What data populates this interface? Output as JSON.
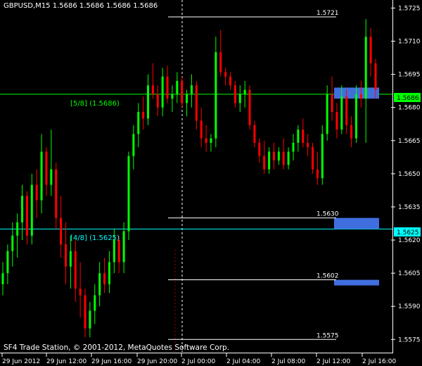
{
  "window": {
    "symbol_header": "GBPUSD,M15  1.5686 1.5686 1.5686 1.5686",
    "copyright": "SF4 Trade Station, © 2001-2012, MetaQuotes Software Corp."
  },
  "colors": {
    "background": "#000000",
    "bull_candle": "#00ff00",
    "bear_candle": "#ff0000",
    "fib_5_8_line": "#00ff00",
    "fib_4_8_line": "#00ffff",
    "zone": "#3f6fdf",
    "level_line": "#ffffff",
    "current_price_marker": "#00ff00",
    "fib_4_8_marker": "#00ffff"
  },
  "chart_data": {
    "type": "candlestick",
    "ylim": [
      1.557,
      1.5728
    ],
    "price_ticks": [
      "1.5725",
      "1.5710",
      "1.5695",
      "1.5680",
      "1.5665",
      "1.5650",
      "1.5635",
      "1.5620",
      "1.5605",
      "1.5590",
      "1.5575"
    ],
    "price_tick_values": [
      1.5725,
      1.571,
      1.5695,
      1.568,
      1.5665,
      1.565,
      1.5635,
      1.562,
      1.5605,
      1.559,
      1.5575
    ],
    "time_ticks": [
      "29 Jun 2012",
      "29 Jun 12:00",
      "29 Jun 16:00",
      "29 Jun 20:00",
      "2 Jul 00:00",
      "2 Jul 04:00",
      "2 Jul 08:00",
      "2 Jul 12:00",
      "2 Jul 16:00"
    ],
    "current_price": "1.5686",
    "horizontal_lines": [
      {
        "name": "[5/8]",
        "label": "[5/8]  (1.5686)",
        "price": 1.5686
      },
      {
        "name": "[4/8]",
        "label": "[4/8]  (1.5625)",
        "price": 1.5625
      }
    ],
    "fib_4_8_marker": "1.5625",
    "levels": [
      {
        "label": "1.5721",
        "price": 1.5721
      },
      {
        "label": "1.5630",
        "price": 1.563
      },
      {
        "label": "1.5602",
        "price": 1.5602
      },
      {
        "label": "1.5575",
        "price": 1.5575
      }
    ],
    "zones": [
      {
        "low": 1.5684,
        "high": 1.5689
      },
      {
        "low": 1.5625,
        "high": 1.563
      },
      {
        "low": 1.56,
        "high": 1.5602
      }
    ],
    "candles": [
      [
        1.56,
        1.561,
        1.5595,
        1.5605
      ],
      [
        1.5605,
        1.5618,
        1.56,
        1.5615
      ],
      [
        1.5615,
        1.5628,
        1.5608,
        1.5622
      ],
      [
        1.5622,
        1.5632,
        1.5612,
        1.5628
      ],
      [
        1.5628,
        1.5645,
        1.562,
        1.564
      ],
      [
        1.564,
        1.5642,
        1.5618,
        1.5622
      ],
      [
        1.5622,
        1.565,
        1.5618,
        1.5645
      ],
      [
        1.5645,
        1.5652,
        1.563,
        1.5638
      ],
      [
        1.5638,
        1.5668,
        1.5632,
        1.566
      ],
      [
        1.566,
        1.5662,
        1.564,
        1.5645
      ],
      [
        1.5645,
        1.567,
        1.564,
        1.5652
      ],
      [
        1.5652,
        1.5655,
        1.5625,
        1.563
      ],
      [
        1.563,
        1.564,
        1.5612,
        1.5618
      ],
      [
        1.5618,
        1.5628,
        1.56,
        1.5608
      ],
      [
        1.5608,
        1.5622,
        1.5598,
        1.5615
      ],
      [
        1.5615,
        1.562,
        1.5592,
        1.5598
      ],
      [
        1.5598,
        1.561,
        1.5585,
        1.5595
      ],
      [
        1.5595,
        1.5598,
        1.5576,
        1.558
      ],
      [
        1.558,
        1.5592,
        1.5576,
        1.5588
      ],
      [
        1.5588,
        1.56,
        1.5582,
        1.5595
      ],
      [
        1.5595,
        1.561,
        1.559,
        1.5605
      ],
      [
        1.5605,
        1.5612,
        1.5596,
        1.56
      ],
      [
        1.56,
        1.5615,
        1.5596,
        1.561
      ],
      [
        1.561,
        1.5625,
        1.5605,
        1.562
      ],
      [
        1.562,
        1.5622,
        1.5605,
        1.561
      ],
      [
        1.561,
        1.5628,
        1.5605,
        1.5624
      ],
      [
        1.5624,
        1.566,
        1.562,
        1.5658
      ],
      [
        1.5658,
        1.5672,
        1.5652,
        1.5668
      ],
      [
        1.5668,
        1.5682,
        1.5662,
        1.5678
      ],
      [
        1.5678,
        1.5685,
        1.567,
        1.5675
      ],
      [
        1.5675,
        1.5695,
        1.5672,
        1.569
      ],
      [
        1.569,
        1.57,
        1.5684,
        1.5686
      ],
      [
        1.5686,
        1.569,
        1.5676,
        1.568
      ],
      [
        1.568,
        1.5698,
        1.5676,
        1.5694
      ],
      [
        1.5694,
        1.5699,
        1.5682,
        1.5684
      ],
      [
        1.5684,
        1.569,
        1.5678,
        1.5686
      ],
      [
        1.5686,
        1.5696,
        1.5682,
        1.5692
      ],
      [
        1.5692,
        1.5694,
        1.568,
        1.5682
      ],
      [
        1.5682,
        1.5688,
        1.5676,
        1.5686
      ],
      [
        1.5686,
        1.5695,
        1.568,
        1.569
      ],
      [
        1.569,
        1.5692,
        1.567,
        1.5674
      ],
      [
        1.5674,
        1.568,
        1.5662,
        1.5666
      ],
      [
        1.5666,
        1.5672,
        1.566,
        1.5664
      ],
      [
        1.5664,
        1.5668,
        1.566,
        1.5666
      ],
      [
        1.5666,
        1.5712,
        1.5662,
        1.5705
      ],
      [
        1.5705,
        1.5715,
        1.5694,
        1.5696
      ],
      [
        1.5696,
        1.5698,
        1.569,
        1.5694
      ],
      [
        1.5694,
        1.5696,
        1.5688,
        1.569
      ],
      [
        1.569,
        1.5692,
        1.568,
        1.5682
      ],
      [
        1.5682,
        1.569,
        1.5678,
        1.5686
      ],
      [
        1.5686,
        1.5692,
        1.568,
        1.5688
      ],
      [
        1.5688,
        1.569,
        1.567,
        1.5672
      ],
      [
        1.5672,
        1.5674,
        1.5662,
        1.5664
      ],
      [
        1.5664,
        1.5666,
        1.5655,
        1.5658
      ],
      [
        1.5658,
        1.5665,
        1.565,
        1.5652
      ],
      [
        1.5652,
        1.5662,
        1.565,
        1.566
      ],
      [
        1.566,
        1.5664,
        1.5652,
        1.5656
      ],
      [
        1.5656,
        1.5662,
        1.5654,
        1.566
      ],
      [
        1.566,
        1.5666,
        1.5652,
        1.5654
      ],
      [
        1.5654,
        1.5662,
        1.5652,
        1.566
      ],
      [
        1.566,
        1.5668,
        1.5656,
        1.5664
      ],
      [
        1.5664,
        1.5672,
        1.566,
        1.567
      ],
      [
        1.567,
        1.5675,
        1.5662,
        1.5664
      ],
      [
        1.5664,
        1.5668,
        1.5658,
        1.5662
      ],
      [
        1.5662,
        1.5664,
        1.565,
        1.5652
      ],
      [
        1.5652,
        1.566,
        1.5645,
        1.5648
      ],
      [
        1.5648,
        1.5672,
        1.5645,
        1.5668
      ],
      [
        1.5668,
        1.569,
        1.5665,
        1.5686
      ],
      [
        1.5686,
        1.5694,
        1.5674,
        1.5678
      ],
      [
        1.5678,
        1.5682,
        1.5666,
        1.567
      ],
      [
        1.567,
        1.569,
        1.5668,
        1.5685
      ],
      [
        1.5685,
        1.5688,
        1.5668,
        1.5672
      ],
      [
        1.5672,
        1.5676,
        1.5662,
        1.5666
      ],
      [
        1.5666,
        1.569,
        1.5664,
        1.5686
      ],
      [
        1.5686,
        1.5692,
        1.568,
        1.5684
      ],
      [
        1.5684,
        1.572,
        1.5664,
        1.5712
      ],
      [
        1.5712,
        1.5716,
        1.5694,
        1.57
      ],
      [
        1.57,
        1.5702,
        1.5684,
        1.5688
      ]
    ]
  }
}
